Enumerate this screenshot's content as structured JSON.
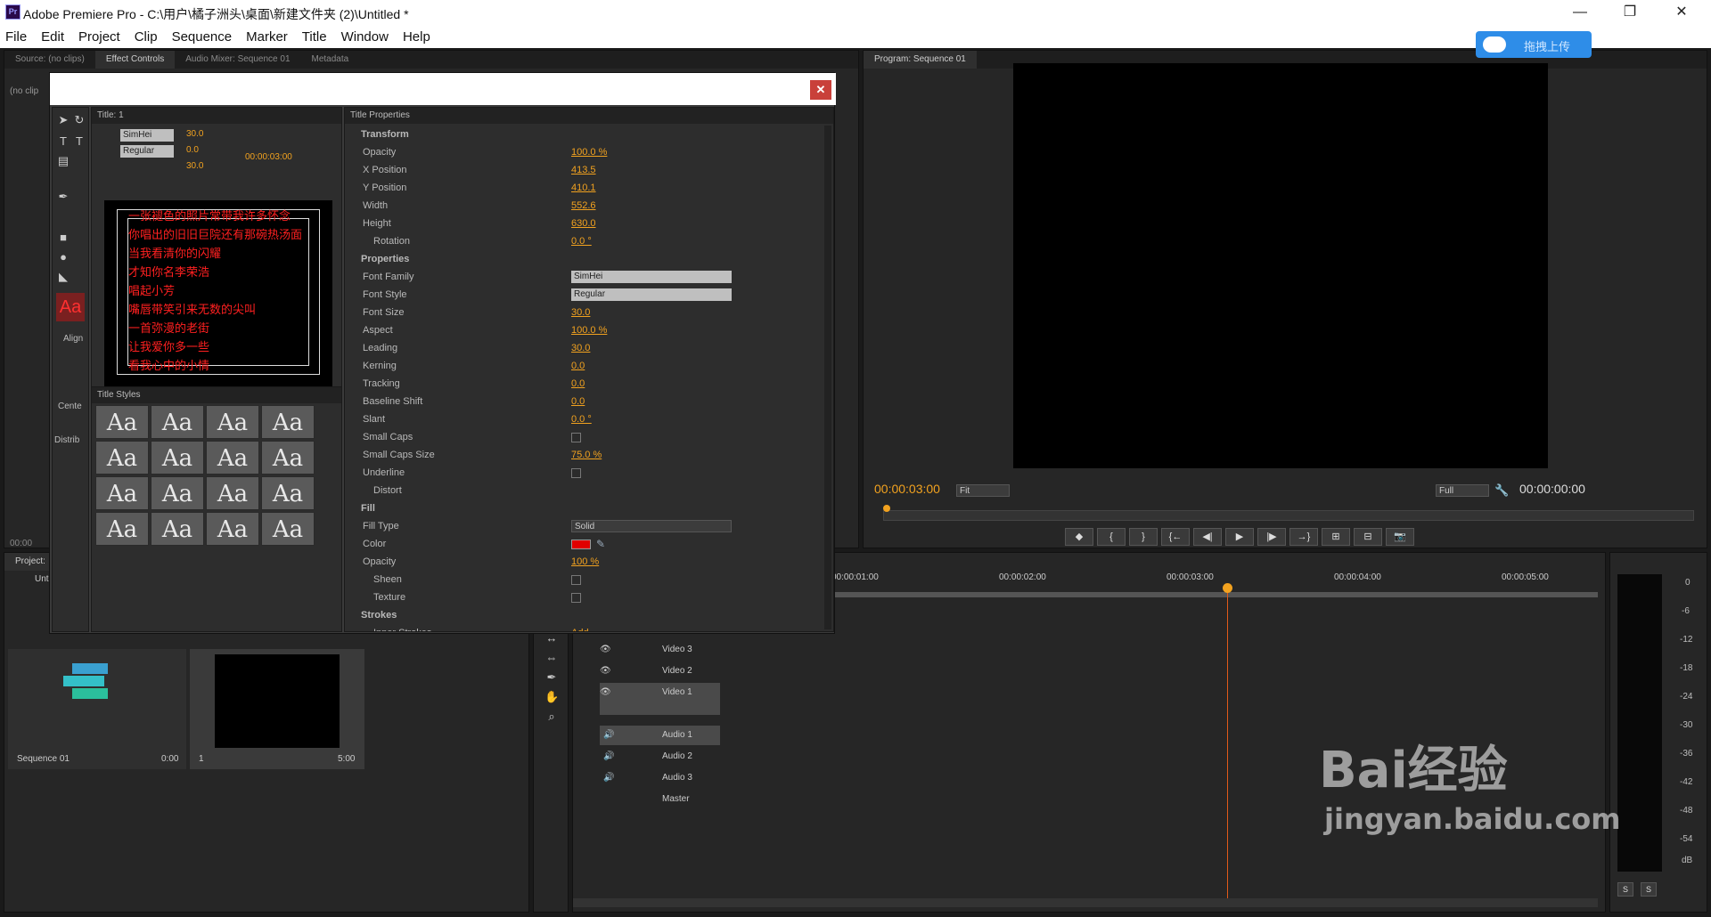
{
  "app": {
    "title": "Adobe Premiere Pro - C:\\用户\\橘子洲头\\桌面\\新建文件夹 (2)\\Untitled *",
    "logo": "Pr",
    "minimize": "—",
    "maximize": "❐",
    "close": "✕"
  },
  "menu": [
    "File",
    "Edit",
    "Project",
    "Clip",
    "Sequence",
    "Marker",
    "Title",
    "Window",
    "Help"
  ],
  "cloud_upload": {
    "label": "拖拽上传",
    "icon": "cloud-icon"
  },
  "source_panel": {
    "tabs": [
      "Source: (no clips)",
      "Effect Controls",
      "Audio Mixer: Sequence 01",
      "Metadata"
    ],
    "active": 1,
    "clip_label": "(no clip",
    "timecode": "00:00"
  },
  "program_panel": {
    "tab": "Program: Sequence 01",
    "timecode_left": "00:00:03:00",
    "fit": "Fit",
    "quality": "Full",
    "timecode_right": "00:00:00:00",
    "transport": [
      "◆",
      "{",
      "}",
      "{←",
      "◀|",
      "▶",
      "|▶",
      "→}",
      "⊞",
      "⊟",
      "📷"
    ]
  },
  "project_panel": {
    "tab": "Project:",
    "sub": "Unt",
    "sequence_name": "Sequence 01",
    "sequence_dur": "0:00",
    "clip_index": "1",
    "clip_dur": "5:00"
  },
  "titler": {
    "close": "✕",
    "title_tab": "Title: 1",
    "font_family": "SimHei",
    "font_style": "Regular",
    "font_size": "30.0",
    "kerning": "0.0",
    "leading": "30.0",
    "timecode": "00:00:03:00",
    "tool_labels": [
      "Align",
      "Cente",
      "Distrib"
    ],
    "lyrics": [
      "一张褪色的照片常带我许多怀念",
      "你唱出的旧旧巨院还有那碗热汤面",
      "当我看清你的闪耀",
      "才知你名李荣浩",
      "唱起小芳",
      "嘴唇带笑引来无数的尖叫",
      "一首弥漫的老街",
      "让我爱你多一些",
      "看我心中的小情"
    ],
    "styles_tab": "Title Styles",
    "style_sample": "Aa",
    "props_tab": "Title Properties",
    "properties": [
      {
        "type": "group",
        "label": "Transform"
      },
      {
        "label": "Opacity",
        "value": "100.0 %"
      },
      {
        "label": "X Position",
        "value": "413.5"
      },
      {
        "label": "Y Position",
        "value": "410.1"
      },
      {
        "label": "Width",
        "value": "552.6"
      },
      {
        "label": "Height",
        "value": "630.0"
      },
      {
        "type": "sub",
        "label": "Rotation",
        "value": "0.0 °"
      },
      {
        "type": "group",
        "label": "Properties"
      },
      {
        "label": "Font Family",
        "select": "SimHei"
      },
      {
        "label": "Font Style",
        "select": "Regular"
      },
      {
        "label": "Font Size",
        "value": "30.0"
      },
      {
        "label": "Aspect",
        "value": "100.0 %"
      },
      {
        "label": "Leading",
        "value": "30.0"
      },
      {
        "label": "Kerning",
        "value": "0.0"
      },
      {
        "label": "Tracking",
        "value": "0.0"
      },
      {
        "label": "Baseline Shift",
        "value": "0.0"
      },
      {
        "label": "Slant",
        "value": "0.0 °"
      },
      {
        "label": "Small Caps",
        "check": true
      },
      {
        "label": "Small Caps Size",
        "value": "75.0 %"
      },
      {
        "label": "Underline",
        "check": true
      },
      {
        "type": "sub",
        "label": "Distort"
      },
      {
        "type": "group",
        "label": "Fill",
        "checked": true
      },
      {
        "label": "Fill Type",
        "select": "Solid"
      },
      {
        "label": "Color",
        "color": "#e00000"
      },
      {
        "label": "Opacity",
        "value": "100 %"
      },
      {
        "type": "sub",
        "label": "Sheen",
        "check": true
      },
      {
        "type": "sub",
        "label": "Texture",
        "check": true
      },
      {
        "type": "group",
        "label": "Strokes"
      },
      {
        "type": "sub",
        "label": "Inner Strokes",
        "value": "Add"
      }
    ]
  },
  "timeline": {
    "ruler": [
      "00:00:01:00",
      "00:00:02:00",
      "00:00:03:00",
      "00:00:04:00",
      "00:00:05:00"
    ],
    "tracks": [
      "Video 3",
      "Video 2",
      "Video 1",
      "Audio 1",
      "Audio 2",
      "Audio 3",
      "Master"
    ]
  },
  "meters": {
    "labels": [
      "0",
      "-6",
      "-12",
      "-18",
      "-24",
      "-30",
      "-36",
      "-42",
      "-48",
      "-54",
      "dB"
    ],
    "solo": "S"
  },
  "watermark": {
    "brand": "Bai经验",
    "url": "jingyan.baidu.com"
  },
  "colors": {
    "accent": "#f2a21f",
    "fill_red": "#e00000",
    "playhead": "#e05a1a"
  }
}
